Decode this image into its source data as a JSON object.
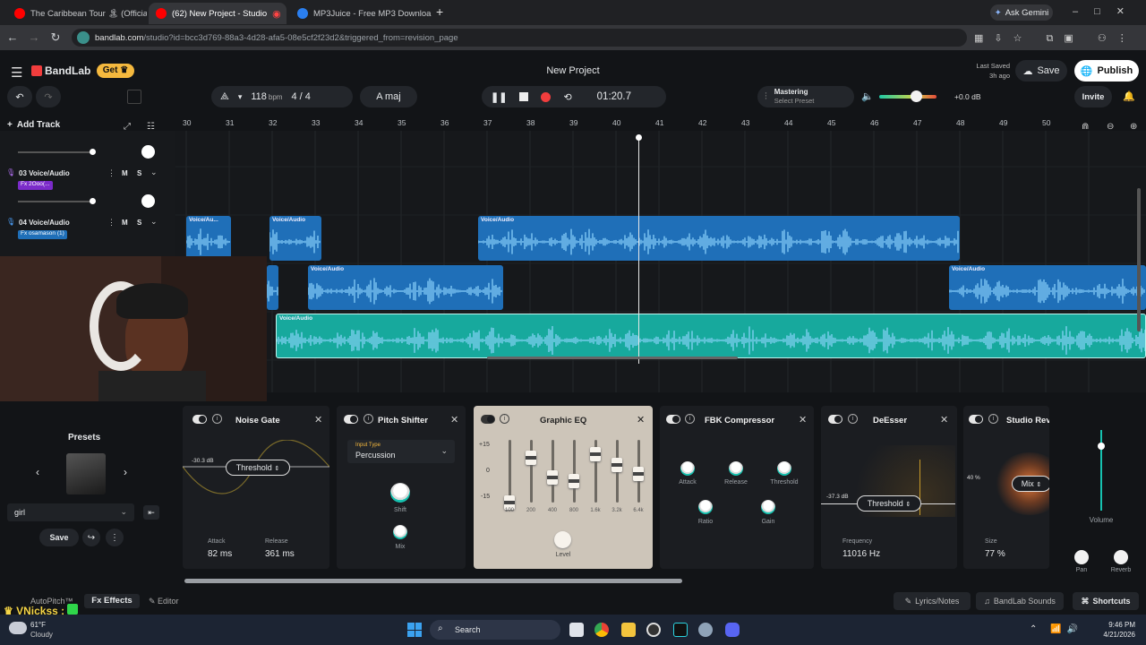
{
  "browser": {
    "tabs": [
      {
        "title": "The Caribbean Tour 🏝 (Officia",
        "active": false
      },
      {
        "title": "(62) New Project - Studio",
        "active": true
      },
      {
        "title": "MP3Juice - Free MP3 Downloa",
        "active": false
      }
    ],
    "new_tab": "+",
    "ask_gemini": "Ask Gemini",
    "url_host": "bandlab.com",
    "url_path": "/studio?id=bcc3d769-88a3-4d28-afa5-08e5cf2f23d2&triggered_from=revision_page"
  },
  "app": {
    "brand": "BandLab",
    "get_label": "Get",
    "project_title": "New Project",
    "last_saved_label": "Last Saved",
    "last_saved_value": "3h ago",
    "save": "Save",
    "publish": "Publish",
    "invite": "Invite"
  },
  "transport": {
    "bpm": "118",
    "bpm_unit": "bpm",
    "time_sig": "4 / 4",
    "key": "A maj",
    "time": "01:20.7",
    "mastering_title": "Mastering",
    "mastering_preset": "Select Preset",
    "volume_db": "+0.0 dB"
  },
  "tracks": {
    "add_track": "Add Track",
    "list": [
      {
        "num": "03",
        "name": "Voice/Audio",
        "fx": "Fx  2Ooo(...",
        "m": "M",
        "s": "S"
      },
      {
        "num": "04",
        "name": "Voice/Audio",
        "fx": "Fx osamason (1)",
        "m": "M",
        "s": "S"
      }
    ]
  },
  "ruler": [
    "30",
    "31",
    "32",
    "33",
    "34",
    "35",
    "36",
    "37",
    "38",
    "39",
    "40",
    "41",
    "42",
    "43",
    "44",
    "45",
    "46",
    "47",
    "48",
    "49",
    "50"
  ],
  "clips": {
    "label": "Voice/Audio",
    "short_label": "Voice/Au..."
  },
  "presets": {
    "title": "Presets",
    "name": "girl",
    "save": "Save"
  },
  "effects": [
    {
      "title": "Noise Gate",
      "db": "-30.3 dB",
      "control": "Threshold",
      "attack_label": "Attack",
      "attack": "82 ms",
      "release_label": "Release",
      "release": "361 ms"
    },
    {
      "title": "Pitch Shifter",
      "input_type_label": "Input Type",
      "input_type": "Percussion",
      "shift": "Shift",
      "mix": "Mix"
    },
    {
      "title": "Graphic EQ",
      "db_top": "+15",
      "db_mid": "0",
      "db_bot": "-15",
      "bands": [
        "100",
        "200",
        "400",
        "800",
        "1.6k",
        "3.2k",
        "6.4k"
      ],
      "level": "Level"
    },
    {
      "title": "FBK Compressor",
      "attack": "Attack",
      "release": "Release",
      "threshold": "Threshold",
      "ratio": "Ratio",
      "gain": "Gain"
    },
    {
      "title": "DeEsser",
      "db": "-37.3 dB",
      "control": "Threshold",
      "freq_label": "Frequency",
      "freq": "11016 Hz"
    },
    {
      "title": "Studio Reve",
      "pct": "40 %",
      "control": "Mix",
      "size_label": "Size",
      "size": "77 %"
    }
  ],
  "mixer": {
    "volume": "Volume",
    "pan": "Pan",
    "reverb": "Reverb"
  },
  "bottom": {
    "autopitch": "AutoPitch™",
    "effects": "Effects",
    "editor": "Editor",
    "lyrics": "Lyrics/Notes",
    "sounds": "BandLab Sounds",
    "shortcuts": "Shortcuts"
  },
  "overlay": {
    "username": "VNickss :"
  },
  "taskbar": {
    "temp": "61°F",
    "weather": "Cloudy",
    "search": "Search",
    "time": "9:46 PM",
    "date": "4/21/2026"
  },
  "colors": {
    "accent": "#16c2b0",
    "brand": "#f23d3d",
    "clip_blue": "#1f6fb8",
    "clip_teal": "#17a99d"
  }
}
